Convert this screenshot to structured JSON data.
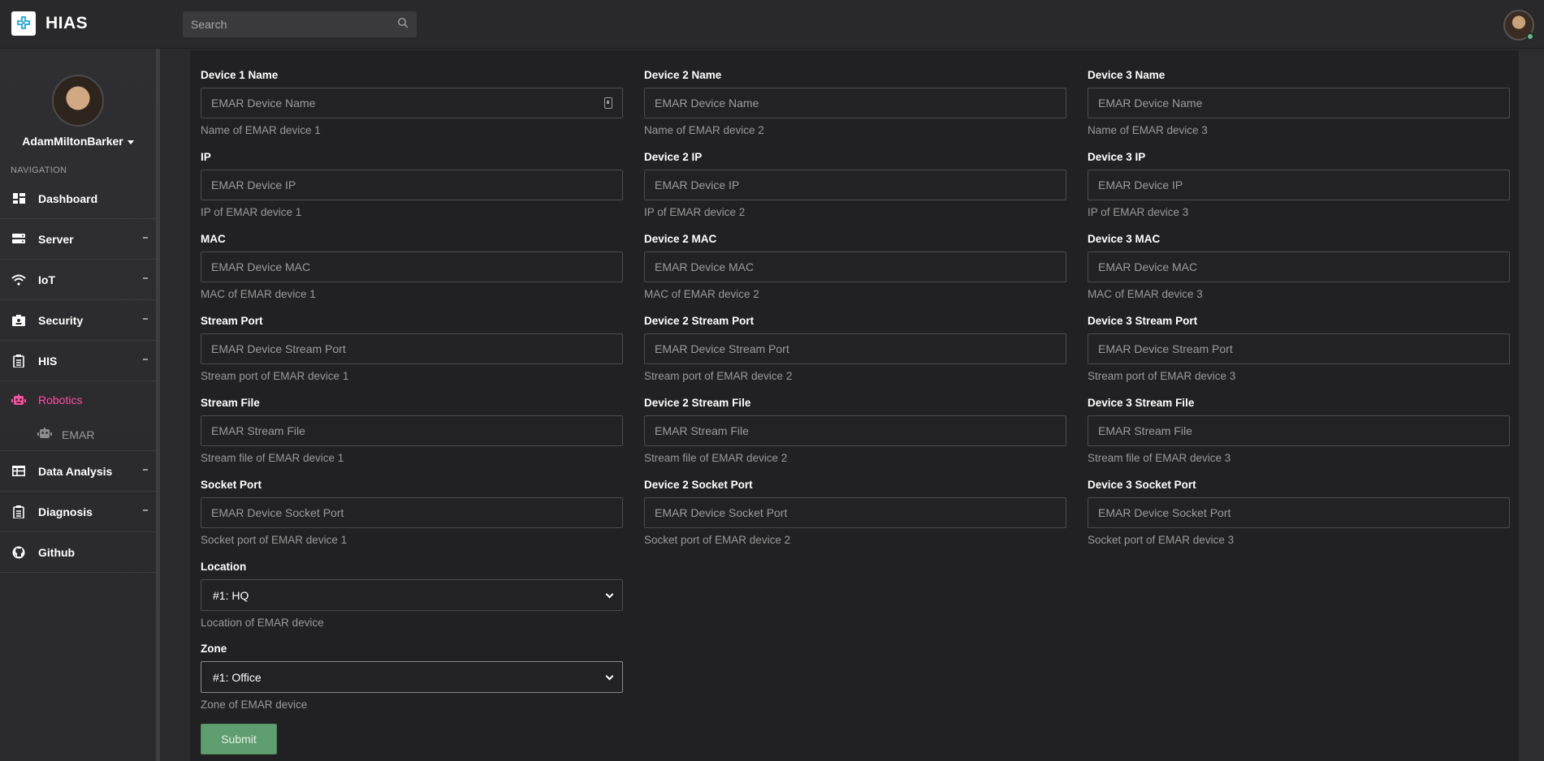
{
  "app": {
    "brand": "HIAS"
  },
  "search": {
    "placeholder": "Search"
  },
  "profile": {
    "username": "AdamMiltonBarker"
  },
  "navigation": {
    "heading": "NAVIGATION",
    "items": [
      {
        "label": "Dashboard",
        "icon": "dashboard-icon"
      },
      {
        "label": "Server",
        "icon": "server-icon"
      },
      {
        "label": "IoT",
        "icon": "wifi-icon"
      },
      {
        "label": "Security",
        "icon": "id-card-icon"
      },
      {
        "label": "HIS",
        "icon": "hospital-icon"
      },
      {
        "label": "Robotics",
        "icon": "robot-icon",
        "active": true
      },
      {
        "label": "EMAR",
        "icon": "robot-icon",
        "sub": true
      },
      {
        "label": "Data Analysis",
        "icon": "table-icon"
      },
      {
        "label": "Diagnosis",
        "icon": "clipboard-icon"
      },
      {
        "label": "Github",
        "icon": "github-icon"
      }
    ]
  },
  "form": {
    "columns": [
      {
        "fields": [
          {
            "label": "Device 1 Name",
            "placeholder": "EMAR Device Name",
            "help": "Name of EMAR device 1"
          },
          {
            "label": "IP",
            "placeholder": "EMAR Device IP",
            "help": "IP of EMAR device 1"
          },
          {
            "label": "MAC",
            "placeholder": "EMAR Device MAC",
            "help": "MAC of EMAR device 1"
          },
          {
            "label": "Stream Port",
            "placeholder": "EMAR Device Stream Port",
            "help": "Stream port of EMAR device 1"
          },
          {
            "label": "Stream File",
            "placeholder": "EMAR Stream File",
            "help": "Stream file of EMAR device 1"
          },
          {
            "label": "Socket Port",
            "placeholder": "EMAR Device Socket Port",
            "help": "Socket port of EMAR device 1"
          }
        ]
      },
      {
        "fields": [
          {
            "label": "Device 2 Name",
            "placeholder": "EMAR Device Name",
            "help": "Name of EMAR device 2"
          },
          {
            "label": "Device 2 IP",
            "placeholder": "EMAR Device IP",
            "help": "IP of EMAR device 2"
          },
          {
            "label": "Device 2 MAC",
            "placeholder": "EMAR Device MAC",
            "help": "MAC of EMAR device 2"
          },
          {
            "label": "Device 2 Stream Port",
            "placeholder": "EMAR Device Stream Port",
            "help": "Stream port of EMAR device 2"
          },
          {
            "label": "Device 2 Stream File",
            "placeholder": "EMAR Stream File",
            "help": "Stream file of EMAR device 2"
          },
          {
            "label": "Device 2 Socket Port",
            "placeholder": "EMAR Device Socket Port",
            "help": "Socket port of EMAR device 2"
          }
        ]
      },
      {
        "fields": [
          {
            "label": "Device 3 Name",
            "placeholder": "EMAR Device Name",
            "help": "Name of EMAR device 3"
          },
          {
            "label": "Device 3 IP",
            "placeholder": "EMAR Device IP",
            "help": "IP of EMAR device 3"
          },
          {
            "label": "Device 3 MAC",
            "placeholder": "EMAR Device MAC",
            "help": "MAC of EMAR device 3"
          },
          {
            "label": "Device 3 Stream Port",
            "placeholder": "EMAR Device Stream Port",
            "help": "Stream port of EMAR device 3"
          },
          {
            "label": "Device 3 Stream File",
            "placeholder": "EMAR Stream File",
            "help": "Stream file of EMAR device 3"
          },
          {
            "label": "Device 3 Socket Port",
            "placeholder": "EMAR Device Socket Port",
            "help": "Socket port of EMAR device 3"
          }
        ]
      }
    ],
    "location": {
      "label": "Location",
      "value": "#1: HQ",
      "help": "Location of EMAR device"
    },
    "zone": {
      "label": "Zone",
      "value": "#1: Office",
      "help": "Zone of EMAR device"
    },
    "submit_label": "Submit"
  },
  "colors": {
    "accent_active": "#ff4fa3",
    "submit": "#5f9e6e",
    "background": "#212123"
  }
}
